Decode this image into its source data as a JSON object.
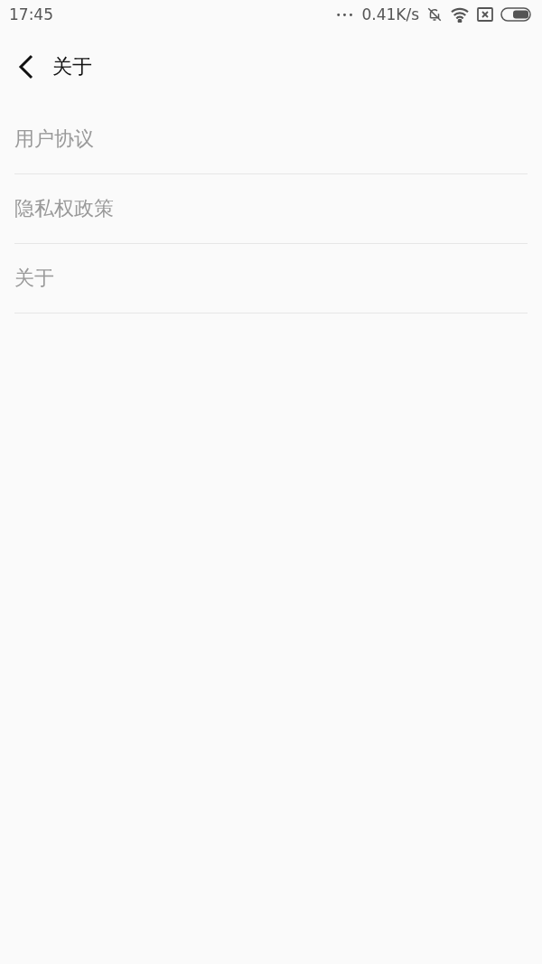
{
  "status_bar": {
    "time": "17:45",
    "dots": "•••",
    "net_speed": "0.41K/s"
  },
  "header": {
    "title": "关于"
  },
  "menu": {
    "items": [
      {
        "label": "用户协议"
      },
      {
        "label": "隐私权政策"
      },
      {
        "label": "关于"
      }
    ]
  }
}
